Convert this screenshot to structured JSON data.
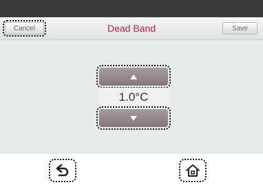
{
  "header": {
    "title": "Dead Band",
    "cancel_label": "Cancel",
    "save_label": "Save"
  },
  "setting": {
    "value": "1.0°C",
    "up_icon": "arrow-up",
    "down_icon": "arrow-down"
  },
  "footer": {
    "back_icon": "back-arrow",
    "home_icon": "home"
  },
  "colors": {
    "title": "#c2195b",
    "topbar": "#3a3a3c",
    "content_bg": "#e7ebea",
    "arrow_button": "#857579"
  }
}
